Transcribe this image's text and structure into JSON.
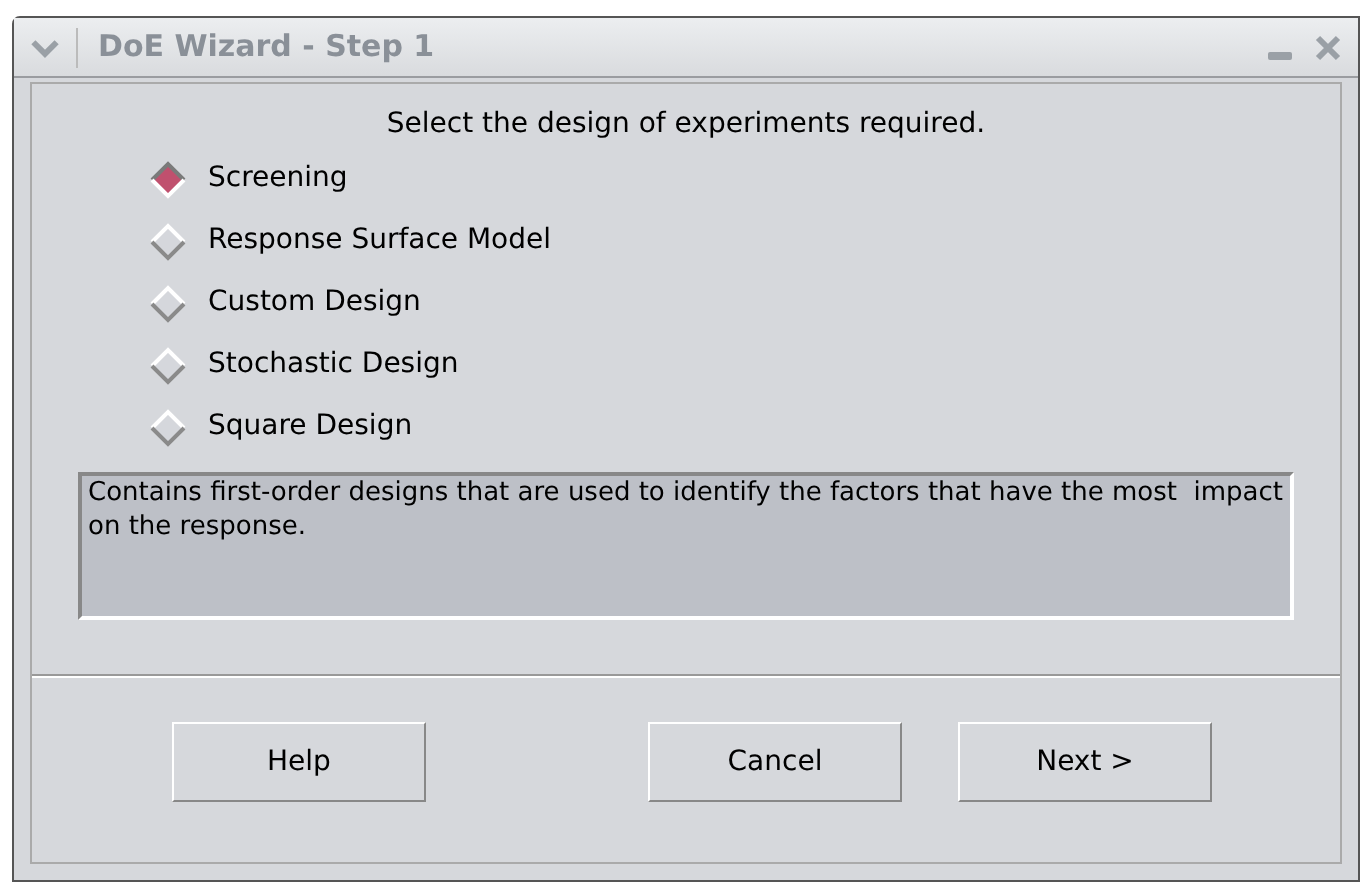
{
  "window": {
    "title": "DoE Wizard - Step 1"
  },
  "prompt": "Select the design of experiments required.",
  "options": [
    {
      "label": "Screening",
      "selected": true
    },
    {
      "label": "Response Surface Model",
      "selected": false
    },
    {
      "label": "Custom Design",
      "selected": false
    },
    {
      "label": "Stochastic Design",
      "selected": false
    },
    {
      "label": "Square Design",
      "selected": false
    }
  ],
  "description": "Contains first-order designs that are used to identify the factors that have the most  impact on the response.",
  "buttons": [
    "Help",
    "Cancel",
    "Next >"
  ]
}
